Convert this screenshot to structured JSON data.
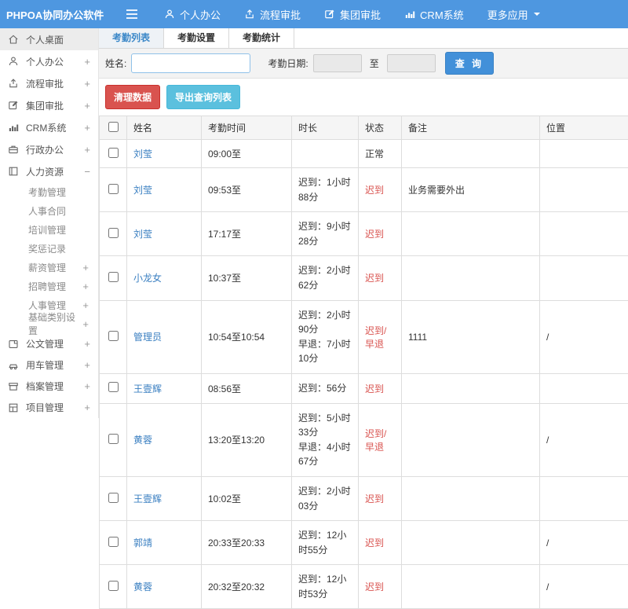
{
  "colors": {
    "navbar_bg": "#4e97e0",
    "link_blue": "#3a7fc1",
    "active_tab_blue": "#3a87c8",
    "danger_red": "#d9534f",
    "info_teal": "#5bc0de",
    "primary_button": "#4290d9"
  },
  "navbar": {
    "logo": "PHPOA协同办公软件",
    "items": [
      {
        "label": "个人办公",
        "icon": "user-icon"
      },
      {
        "label": "流程审批",
        "icon": "flow-icon"
      },
      {
        "label": "集团审批",
        "icon": "edit-icon"
      },
      {
        "label": "CRM系统",
        "icon": "chart-icon"
      },
      {
        "label": "更多应用",
        "icon": "caret-down-icon"
      }
    ]
  },
  "sidebar": {
    "items": [
      {
        "label": "个人桌面",
        "expand": ""
      },
      {
        "label": "个人办公",
        "expand": "+"
      },
      {
        "label": "流程审批",
        "expand": "+"
      },
      {
        "label": "集团审批",
        "expand": "+"
      },
      {
        "label": "CRM系统",
        "expand": "+"
      },
      {
        "label": "行政办公",
        "expand": "+"
      },
      {
        "label": "人力资源",
        "expand": "−"
      }
    ],
    "hr_children": [
      {
        "label": "考勤管理",
        "expand": ""
      },
      {
        "label": "人事合同",
        "expand": ""
      },
      {
        "label": "培训管理",
        "expand": ""
      },
      {
        "label": "奖惩记录",
        "expand": ""
      },
      {
        "label": "薪资管理",
        "expand": "+"
      },
      {
        "label": "招聘管理",
        "expand": "+"
      },
      {
        "label": "人事管理",
        "expand": "+"
      },
      {
        "label": "基础类别设置",
        "expand": "+"
      }
    ],
    "items_bottom": [
      {
        "label": "公文管理",
        "expand": "+"
      },
      {
        "label": "用车管理",
        "expand": "+"
      },
      {
        "label": "档案管理",
        "expand": "+"
      },
      {
        "label": "项目管理",
        "expand": "+"
      }
    ]
  },
  "tabs": [
    {
      "label": "考勤列表",
      "active": true
    },
    {
      "label": "考勤设置",
      "active": false
    },
    {
      "label": "考勤统计",
      "active": false
    }
  ],
  "form": {
    "name_label": "姓名:",
    "name_value": "",
    "date_label": "考勤日期:",
    "date_from_value": "",
    "to_label": "至",
    "date_to_value": "",
    "search_button": "查 询"
  },
  "actions": {
    "clear_button": "清理数据",
    "export_button": "导出查询列表"
  },
  "table": {
    "columns": [
      "姓名",
      "考勤时间",
      "时长",
      "状态",
      "备注",
      "位置"
    ],
    "rows": [
      {
        "name": "刘莹",
        "time": "09:00至",
        "d1": "",
        "d2": "",
        "status": "正常",
        "red": false,
        "note": "",
        "loc": ""
      },
      {
        "name": "刘莹",
        "time": "09:53至",
        "d1": "迟到：1小时88分",
        "d2": "",
        "status": "迟到",
        "red": true,
        "note": "业务需要外出",
        "loc": ""
      },
      {
        "name": "刘莹",
        "time": "17:17至",
        "d1": "迟到：9小时28分",
        "d2": "",
        "status": "迟到",
        "red": true,
        "note": "",
        "loc": ""
      },
      {
        "name": "小龙女",
        "time": "10:37至",
        "d1": "迟到：2小时62分",
        "d2": "",
        "status": "迟到",
        "red": true,
        "note": "",
        "loc": ""
      },
      {
        "name": "管理员",
        "time": "10:54至10:54",
        "d1": "迟到：2小时90分",
        "d2": "早退：7小时10分",
        "status": "迟到/早退",
        "red": true,
        "note": "1111",
        "loc": "/"
      },
      {
        "name": "王壹辉",
        "time": "08:56至",
        "d1": "迟到：56分",
        "d2": "",
        "status": "迟到",
        "red": true,
        "note": "",
        "loc": ""
      },
      {
        "name": "黄蓉",
        "time": "13:20至13:20",
        "d1": "迟到：5小时33分",
        "d2": "早退：4小时67分",
        "status": "迟到/早退",
        "red": true,
        "note": "",
        "loc": "/"
      },
      {
        "name": "王壹辉",
        "time": "10:02至",
        "d1": "迟到：2小时03分",
        "d2": "",
        "status": "迟到",
        "red": true,
        "note": "",
        "loc": ""
      },
      {
        "name": "郭靖",
        "time": "20:33至20:33",
        "d1": "迟到：12小时55分",
        "d2": "",
        "status": "迟到",
        "red": true,
        "note": "",
        "loc": "/"
      },
      {
        "name": "黄蓉",
        "time": "20:32至20:32",
        "d1": "迟到：12小时53分",
        "d2": "",
        "status": "迟到",
        "red": true,
        "note": "",
        "loc": "/"
      }
    ]
  }
}
